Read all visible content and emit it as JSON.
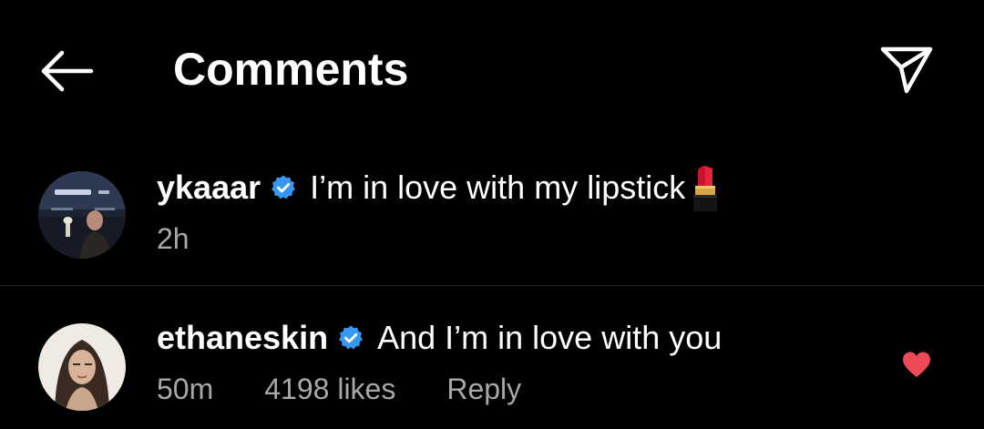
{
  "header": {
    "title": "Comments",
    "back_icon": "arrow-left-icon",
    "share_icon": "paper-plane-icon"
  },
  "comments": [
    {
      "username": "ykaaar",
      "verified": true,
      "text": "I’m in love with my lipstick",
      "emoji": "lipstick",
      "time": "2h"
    },
    {
      "username": "ethaneskin",
      "verified": true,
      "text": "And I’m in love with you",
      "time": "50m",
      "likes": "4198 likes",
      "reply_label": "Reply",
      "liked": true
    }
  ],
  "colors": {
    "background": "#000000",
    "text": "#ffffff",
    "secondary_text": "#a8a8a8",
    "verified_badge": "#3897f0",
    "heart": "#ed4956",
    "divider": "#262626"
  }
}
